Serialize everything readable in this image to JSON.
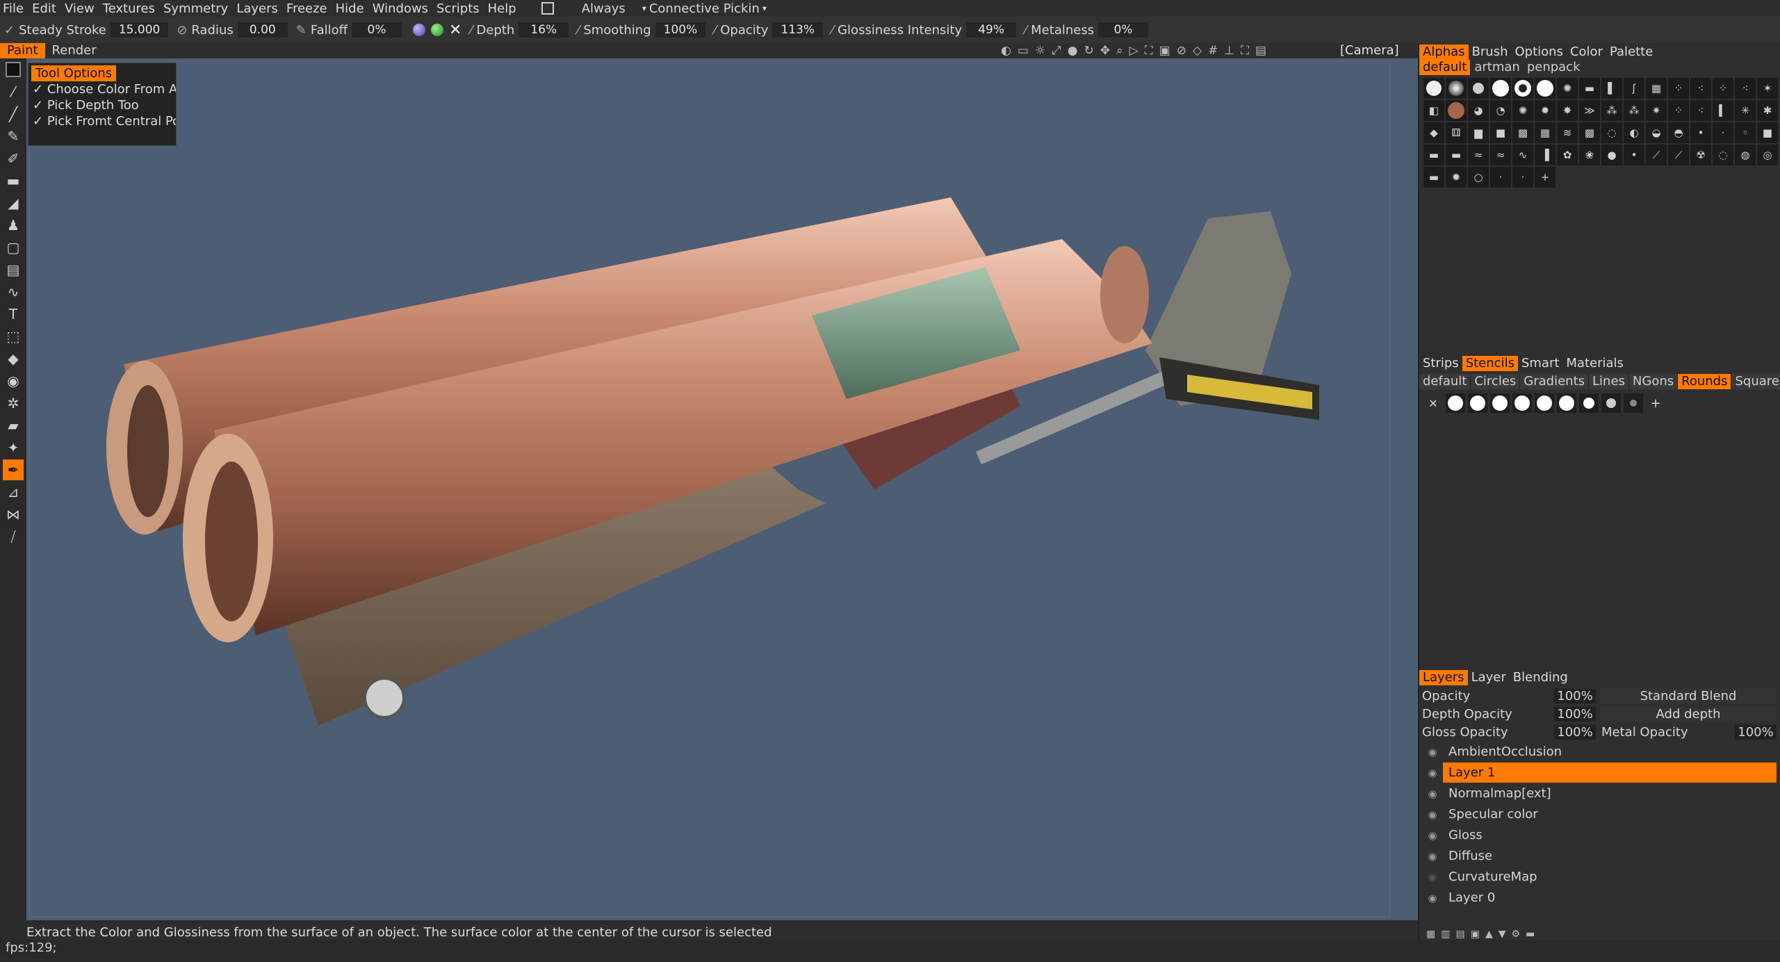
{
  "menu": {
    "items": [
      "File",
      "Edit",
      "View",
      "Textures",
      "Symmetry",
      "Layers",
      "Freeze",
      "Hide",
      "Windows",
      "Scripts",
      "Help"
    ],
    "always_label": "Always",
    "connective_label": "Connective  Pickin"
  },
  "toolbar": {
    "steady_label": "Steady  Stroke",
    "steady_value": "15.000",
    "radius_label": "Radius",
    "radius_value": "0.00",
    "falloff_label": "Falloff",
    "falloff_value": "0%",
    "depth_label": "Depth",
    "depth_value": "16%",
    "smoothing_label": "Smoothing",
    "smoothing_value": "100%",
    "opacity_label": "Opacity",
    "opacity_value": "113%",
    "gloss_label": "Glossiness  Intensity",
    "gloss_value": "49%",
    "metal_label": "Metalness",
    "metal_value": "0%"
  },
  "modes": {
    "paint": "Paint",
    "render": "Render",
    "camera": "[Camera]"
  },
  "tool_options": {
    "title": "Tool  Options",
    "opt1": "Choose  Color  From  A",
    "opt2": "Pick  Depth  Too",
    "opt3": "Pick  Fromt  Central  Po"
  },
  "status": {
    "hint": "Extract  the  Color  and  Glossiness  from  the  surface  of  an  object.  The  surface  color  at  the  center  of  the  cursor  is  selected",
    "fps": "fps:129;"
  },
  "alphas_panel": {
    "tabs": [
      "Alphas",
      "Brush",
      "Options",
      "Color",
      "Palette"
    ],
    "subtabs": [
      "default",
      "artman",
      "penpack"
    ]
  },
  "stencils_panel": {
    "tabs": [
      "Strips",
      "Stencils",
      "Smart",
      "Materials"
    ],
    "subtabs": [
      "default",
      "Circles",
      "Gradients",
      "Lines",
      "NGons",
      "Rounds",
      "Squares"
    ]
  },
  "layers_panel": {
    "tabs": [
      "Layers",
      "Layer",
      "Blending"
    ],
    "opacity_label": "Opacity",
    "opacity_value": "100%",
    "blend_mode": "Standard  Blend",
    "depth_opacity_label": "Depth  Opacity",
    "depth_opacity_value": "100%",
    "depth_mode": "Add  depth",
    "gloss_opacity_label": "Gloss  Opacity",
    "gloss_opacity_value": "100%",
    "metal_opacity_label": "Metal  Opacity",
    "metal_opacity_value": "100%",
    "layers": [
      "AmbientOcclusion",
      "Layer  1",
      "Normalmap[ext]",
      "Specular  color",
      "Gloss",
      "Diffuse",
      "CurvatureMap",
      "Layer  0"
    ]
  },
  "colors": {
    "accent": "#ff7a00",
    "viewport": "#4d5d74"
  }
}
